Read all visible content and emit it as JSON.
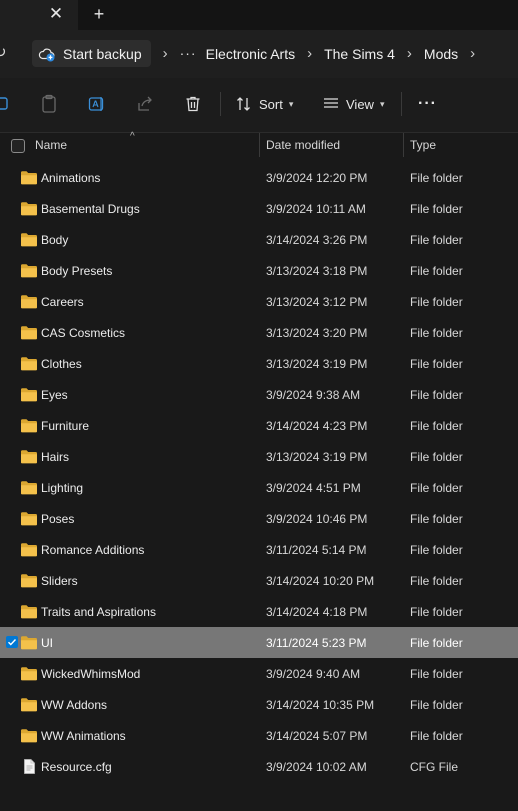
{
  "tabs": {
    "close_glyph": "✕",
    "new_glyph": "+"
  },
  "breadcrumb": {
    "root": "Start backup",
    "overflow": "···",
    "items": [
      "Electronic Arts",
      "The Sims 4",
      "Mods"
    ]
  },
  "toolbar": {
    "sort_label": "Sort",
    "view_label": "View",
    "more_label": "···"
  },
  "columns": {
    "name": "Name",
    "date_modified": "Date modified",
    "type": "Type"
  },
  "files": [
    {
      "name": "Animations",
      "date": "3/9/2024 12:20 PM",
      "type": "File folder",
      "icon": "folder-icon"
    },
    {
      "name": "Basemental Drugs",
      "date": "3/9/2024 10:11 AM",
      "type": "File folder",
      "icon": "folder-icon"
    },
    {
      "name": "Body",
      "date": "3/14/2024 3:26 PM",
      "type": "File folder",
      "icon": "folder-icon"
    },
    {
      "name": "Body Presets",
      "date": "3/13/2024 3:18 PM",
      "type": "File folder",
      "icon": "folder-icon"
    },
    {
      "name": "Careers",
      "date": "3/13/2024 3:12 PM",
      "type": "File folder",
      "icon": "folder-icon"
    },
    {
      "name": "CAS Cosmetics",
      "date": "3/13/2024 3:20 PM",
      "type": "File folder",
      "icon": "folder-icon"
    },
    {
      "name": "Clothes",
      "date": "3/13/2024 3:19 PM",
      "type": "File folder",
      "icon": "folder-icon"
    },
    {
      "name": "Eyes",
      "date": "3/9/2024 9:38 AM",
      "type": "File folder",
      "icon": "folder-icon"
    },
    {
      "name": "Furniture",
      "date": "3/14/2024 4:23 PM",
      "type": "File folder",
      "icon": "folder-icon"
    },
    {
      "name": "Hairs",
      "date": "3/13/2024 3:19 PM",
      "type": "File folder",
      "icon": "folder-icon"
    },
    {
      "name": "Lighting",
      "date": "3/9/2024 4:51 PM",
      "type": "File folder",
      "icon": "folder-icon"
    },
    {
      "name": "Poses",
      "date": "3/9/2024 10:46 PM",
      "type": "File folder",
      "icon": "folder-icon"
    },
    {
      "name": "Romance Additions",
      "date": "3/11/2024 5:14 PM",
      "type": "File folder",
      "icon": "folder-icon"
    },
    {
      "name": "Sliders",
      "date": "3/14/2024 10:20 PM",
      "type": "File folder",
      "icon": "folder-icon"
    },
    {
      "name": "Traits and Aspirations",
      "date": "3/14/2024 4:18 PM",
      "type": "File folder",
      "icon": "folder-icon"
    },
    {
      "name": "UI",
      "date": "3/11/2024 5:23 PM",
      "type": "File folder",
      "icon": "folder-icon",
      "selected": true
    },
    {
      "name": "WickedWhimsMod",
      "date": "3/9/2024 9:40 AM",
      "type": "File folder",
      "icon": "folder-icon"
    },
    {
      "name": "WW Addons",
      "date": "3/14/2024 10:35 PM",
      "type": "File folder",
      "icon": "folder-icon"
    },
    {
      "name": "WW Animations",
      "date": "3/14/2024 5:07 PM",
      "type": "File folder",
      "icon": "folder-icon"
    },
    {
      "name": "Resource.cfg",
      "date": "3/9/2024 10:02 AM",
      "type": "CFG File",
      "icon": "file-icon"
    }
  ],
  "colors": {
    "folder": "#f4c14b",
    "folder_dark": "#dba731",
    "accent": "#0078d4",
    "selection": "#777777"
  }
}
